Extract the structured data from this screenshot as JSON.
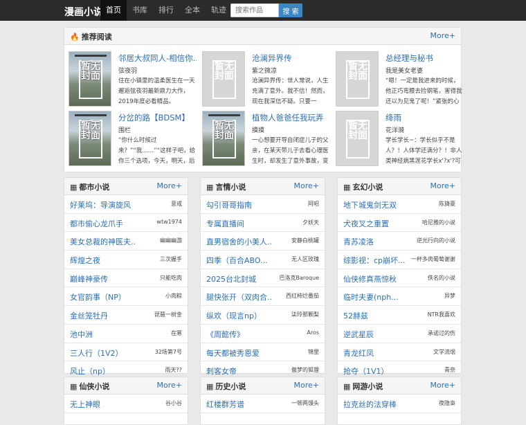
{
  "header": {
    "brand": "漫画小说",
    "nav": [
      "首页",
      "书库",
      "排行",
      "全本",
      "轨迹"
    ],
    "search_placeholder": "搜索作品",
    "search_button": "搜 索"
  },
  "recommend": {
    "title": "推荐阅读",
    "more": "More+",
    "cover_text": "暂无封面",
    "items": [
      {
        "title": "邻居大叔同人-相信你...",
        "author": "弦夜羽",
        "desc": "住在小镇里的温柔医生在一天邂逅弦夜羽最新鼎力大作，2019年度必看精品。",
        "cover": "photo"
      },
      {
        "title": "沧澜异界传",
        "author": "紫之微凉",
        "desc": "沧澜异界传：世人常说，人生充满了意外。我不信！然而，现在我深信不疑。只要一",
        "cover": "blank"
      },
      {
        "title": "总经理与秘书",
        "author": "我是美女老婆",
        "desc": "“嗯！一定是我进来的时候，他正巧弯腰去捡钢笔，害得我还以为见鬼了呢！”紧张的心情",
        "cover": "blank"
      },
      {
        "title": "分岔的路【BDSM】",
        "author": "围栏",
        "desc": "“你什么时候过来？”“我……”“这样子吧，给你三个选项，今天，明天，后天，三选一。”",
        "cover": "photo"
      },
      {
        "title": "植物人爸爸任我玩弄",
        "author": "摸摸",
        "desc": "一心想要开导自闭症儿子的父亲，在某天带儿子去看心理医生时，却发生了意外事故，变",
        "cover": "photo"
      },
      {
        "title": "绛雨",
        "author": "花洋漪",
        "desc": "学长学长~：学长似乎不是人？！人体学还满分？！非人类神经病黑莲花学长x'?x'?可盐可",
        "cover": "blank"
      }
    ]
  },
  "categories": [
    {
      "title": "都市小说",
      "more": "More+",
      "rows": [
        {
          "book": "好莱坞：导演旋风",
          "author": "意戒"
        },
        {
          "book": "都市偷心龙爪手",
          "author": "wtw1974"
        },
        {
          "book": "美女总裁的神医夫...",
          "author": "幽幽幽游"
        },
        {
          "book": "辉煌之夜",
          "author": "三次握手"
        },
        {
          "book": "巅峰神豪传",
          "author": "只能吃肉"
        },
        {
          "book": "女官韵事（NP）",
          "author": "小肉粽"
        },
        {
          "book": "金丝笼牡丹",
          "author": "琵琶一树金"
        },
        {
          "book": "池中洲",
          "author": "在寒"
        },
        {
          "book": "三人行（1V2）",
          "author": "32场第7号"
        },
        {
          "book": "风止（np）",
          "author": "雨天??"
        }
      ]
    },
    {
      "title": "言情小说",
      "more": "More+",
      "rows": [
        {
          "book": "勾引哥哥指南",
          "author": "阿昭"
        },
        {
          "book": "专属直播间",
          "author": "夕妖天"
        },
        {
          "book": "直男宿舍的小美人...",
          "author": "安静白桃罐"
        },
        {
          "book": "四季（百合ABO...",
          "author": "无人区玫瑰"
        },
        {
          "book": "2025台北封城",
          "author": "巴洛克Baroque"
        },
        {
          "book": "腿快张开（双肉合...",
          "author": "西红柿烂番茄"
        },
        {
          "book": "纵欢（现言np）",
          "author": "柒玲那颗梨"
        },
        {
          "book": "《周懿传》",
          "author": "Aros"
        },
        {
          "book": "每天都被秀恩爱",
          "author": "锦里"
        },
        {
          "book": "刺客女帝",
          "author": "傲梦的狐狸"
        }
      ]
    },
    {
      "title": "玄幻小说",
      "more": "More+",
      "rows": [
        {
          "book": "地下城鬼剑无双",
          "author": "陈旖豪"
        },
        {
          "book": "犬夜叉之重置",
          "author": "哈尼雅的小说"
        },
        {
          "book": "青苏凌洛",
          "author": "逆光行向的小说"
        },
        {
          "book": "综影视：cp崩坏...",
          "author": "一杯多肉葡萄谢谢"
        },
        {
          "book": "仙侠修真燕惊秋",
          "author": "佚名的小说"
        },
        {
          "book": "临时夫妻(nph...",
          "author": "异梦"
        },
        {
          "book": "52赫兹",
          "author": "NTR我喜欢"
        },
        {
          "book": "逆武星辰",
          "author": "承诺过的伤"
        },
        {
          "book": "青龙红凤",
          "author": "文学流氓"
        },
        {
          "book": "抢夺（1V1）",
          "author": "青奈"
        }
      ]
    },
    {
      "title": "仙侠小说",
      "more": "More+",
      "rows": [
        {
          "book": "无上神眼",
          "author": "谷小谷"
        }
      ]
    },
    {
      "title": "历史小说",
      "more": "More+",
      "rows": [
        {
          "book": "红楼群芳谱",
          "author": "一顿两馒头"
        }
      ]
    },
    {
      "title": "网游小说",
      "more": "More+",
      "rows": [
        {
          "book": "拉克丝的法穿棒",
          "author": "夜隐枭"
        }
      ]
    }
  ]
}
